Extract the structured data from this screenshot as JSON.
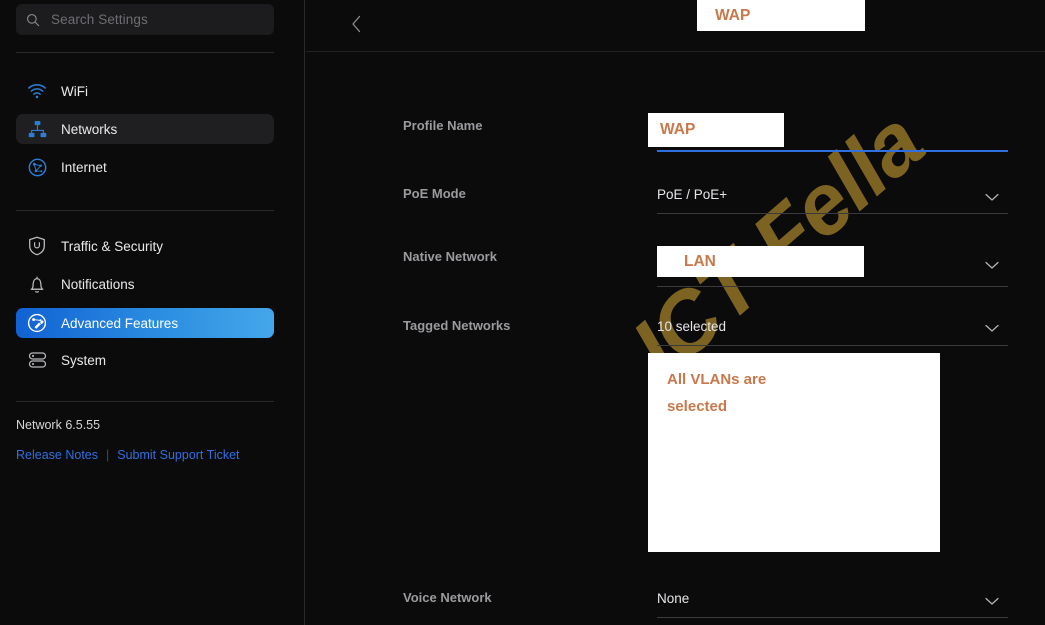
{
  "sidebar": {
    "search": {
      "placeholder": "Search Settings",
      "icon": "search-icon"
    },
    "items": [
      {
        "label": "WiFi",
        "icon": "wifi-icon",
        "state": "normal"
      },
      {
        "label": "Networks",
        "icon": "networks-icon",
        "state": "hover"
      },
      {
        "label": "Internet",
        "icon": "internet-icon",
        "state": "normal"
      },
      {
        "label": "Traffic & Security",
        "icon": "shield-icon",
        "state": "normal"
      },
      {
        "label": "Notifications",
        "icon": "bell-icon",
        "state": "normal"
      },
      {
        "label": "Advanced Features",
        "icon": "advanced-icon",
        "state": "selected"
      },
      {
        "label": "System",
        "icon": "system-icon",
        "state": "normal"
      }
    ],
    "version": "Network 6.5.55",
    "release_notes": "Release Notes",
    "support_ticket": "Submit Support Ticket",
    "link_separator": "|"
  },
  "header": {
    "back_icon": "chevron-left-icon",
    "title": "WAP"
  },
  "form": {
    "profile_name": {
      "label": "Profile Name",
      "value": "WAP",
      "focused": true
    },
    "poe_mode": {
      "label": "PoE Mode",
      "value": "PoE / PoE+",
      "chevron": "chevron-down-icon"
    },
    "native_network": {
      "label": "Native Network",
      "value": "LAN",
      "chevron": "chevron-down-icon"
    },
    "tagged_networks": {
      "label": "Tagged Networks",
      "value": "10 selected",
      "chevron": "chevron-down-icon"
    },
    "voice_network": {
      "label": "Voice Network",
      "value": "None",
      "chevron": "chevron-down-icon"
    }
  },
  "annotations": {
    "header_title": "WAP",
    "profile_name": "WAP",
    "native_network": "LAN",
    "tagged_networks": "All VLANs are\nselected",
    "text_color": "#c8784a",
    "box_color": "#ffffff"
  },
  "watermark": {
    "text": "ICT Fella",
    "color": "#7d6322"
  },
  "colors": {
    "background": "#0b0b0b",
    "sidebar_hover": "#1f1f22",
    "accent_blue": "#2f6fe0",
    "icon_blue": "#2a7fd4",
    "label_gray": "#9b9b9f",
    "value_white": "#e6e6ea",
    "link_blue": "#2f6fe0"
  }
}
